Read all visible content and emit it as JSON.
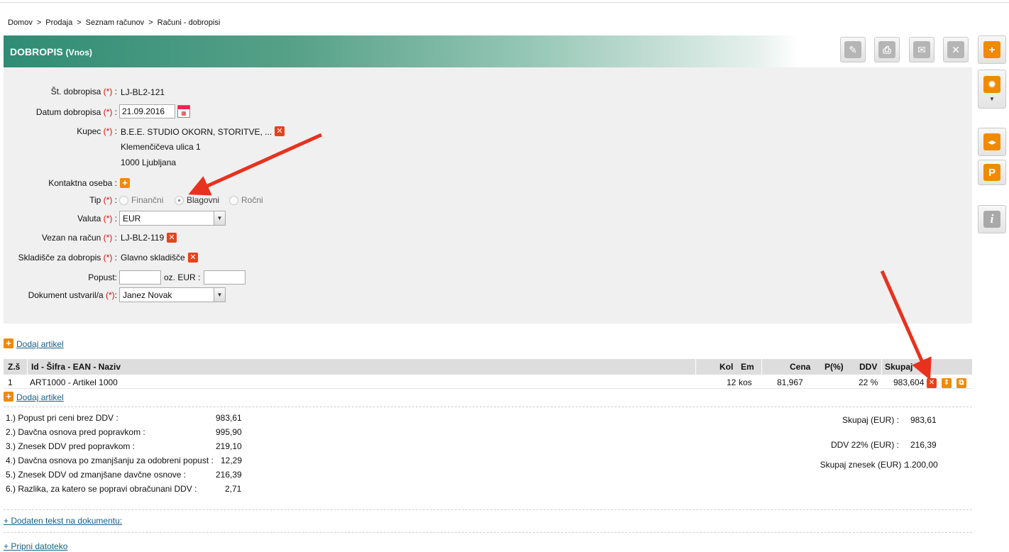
{
  "breadcrumb": [
    "Domov",
    "Prodaja",
    "Seznam računov",
    "Računi - dobropisi"
  ],
  "breadcrumb_sep": ">",
  "header": {
    "title": "DOBROPIS",
    "subtitle": "(Vnos)"
  },
  "toolbar": {
    "icons": [
      "pencil-icon",
      "printer-icon",
      "envelope-icon",
      "close-icon",
      "plus-icon"
    ]
  },
  "side_toolbar": {
    "icons": [
      "gear-icon",
      "split-icon",
      "p-icon",
      "info-icon"
    ],
    "p_label": "P",
    "info_label": "i"
  },
  "form": {
    "req_mark": "(*)",
    "st_label": "Št. dobropisa",
    "st_value": "LJ-BL2-121",
    "datum_label": "Datum dobropisa",
    "datum_value": "21.09.2016",
    "kupec_label": "Kupec",
    "kupec_value": "B.E.E. STUDIO OKORN, STORITVE, ...",
    "kupec_street": "Klemenčičeva ulica 1",
    "kupec_city": "1000 Ljubljana",
    "kontakt_label": "Kontaktna oseba :",
    "tip_label": "Tip",
    "tip_options": [
      "Finančni",
      "Blagovni",
      "Ročni"
    ],
    "tip_selected": "Blagovni",
    "valuta_label": "Valuta",
    "valuta_value": "EUR",
    "vezan_label": "Vezan na račun",
    "vezan_value": "LJ-BL2-119",
    "skladisce_label": "Skladišče za dobropis",
    "skladisce_value": "Glavno skladišče",
    "popust_label": "Popust:",
    "popust_value": "",
    "oz_eur_label": "oz. EUR :",
    "oz_eur_value": "",
    "ustvaril_label": "Dokument ustvaril/a",
    "ustvaril_value": "Janez Novak"
  },
  "items": {
    "add_label": "Dodaj artikel",
    "columns": {
      "zs": "Z.š",
      "naziv": "Id - Šifra - EAN - Naziv",
      "kol": "Kol",
      "em": "Em",
      "cena": "Cena",
      "p": "P(%)",
      "ddv": "DDV",
      "skupaj": "Skupaj"
    },
    "rows": [
      {
        "zs": "1",
        "naziv": "ART1000 - Artikel 1000",
        "kol": "12",
        "em": "kos",
        "cena": "81,967",
        "p": "",
        "ddv": "22 %",
        "skupaj": "983,604"
      }
    ]
  },
  "summary": [
    {
      "label": "1.) Popust pri ceni brez DDV :",
      "value": "983,61"
    },
    {
      "label": "2.) Davčna osnova pred popravkom :",
      "value": "995,90"
    },
    {
      "label": "3.) Znesek DDV pred popravkom :",
      "value": "219,10"
    },
    {
      "label": "4.) Davčna osnova po zmanjšanju za odobreni popust :",
      "value": "12,29"
    },
    {
      "label": "5.) Znesek DDV od zmanjšane davčne osnove :",
      "value": "216,39"
    },
    {
      "label": "6.) Razlika, za katero se popravi obračunani DDV :",
      "value": "2,71"
    }
  ],
  "totals": [
    {
      "label": "Skupaj (EUR) :",
      "value": "983,61"
    },
    {
      "label": "DDV 22% (EUR) :",
      "value": "216,39"
    },
    {
      "label": "Skupaj znesek (EUR) :",
      "value": "1.200,00"
    }
  ],
  "extra": {
    "dodaten_tekst": "+ Dodaten tekst na dokumentu:",
    "pripni": "+ Pripni datoteko"
  },
  "colors": {
    "accent_green": "#2f8c74",
    "orange": "#f08a00",
    "required_red": "#d11",
    "link": "#17608a",
    "annotation_arrow": "#e8321e"
  }
}
